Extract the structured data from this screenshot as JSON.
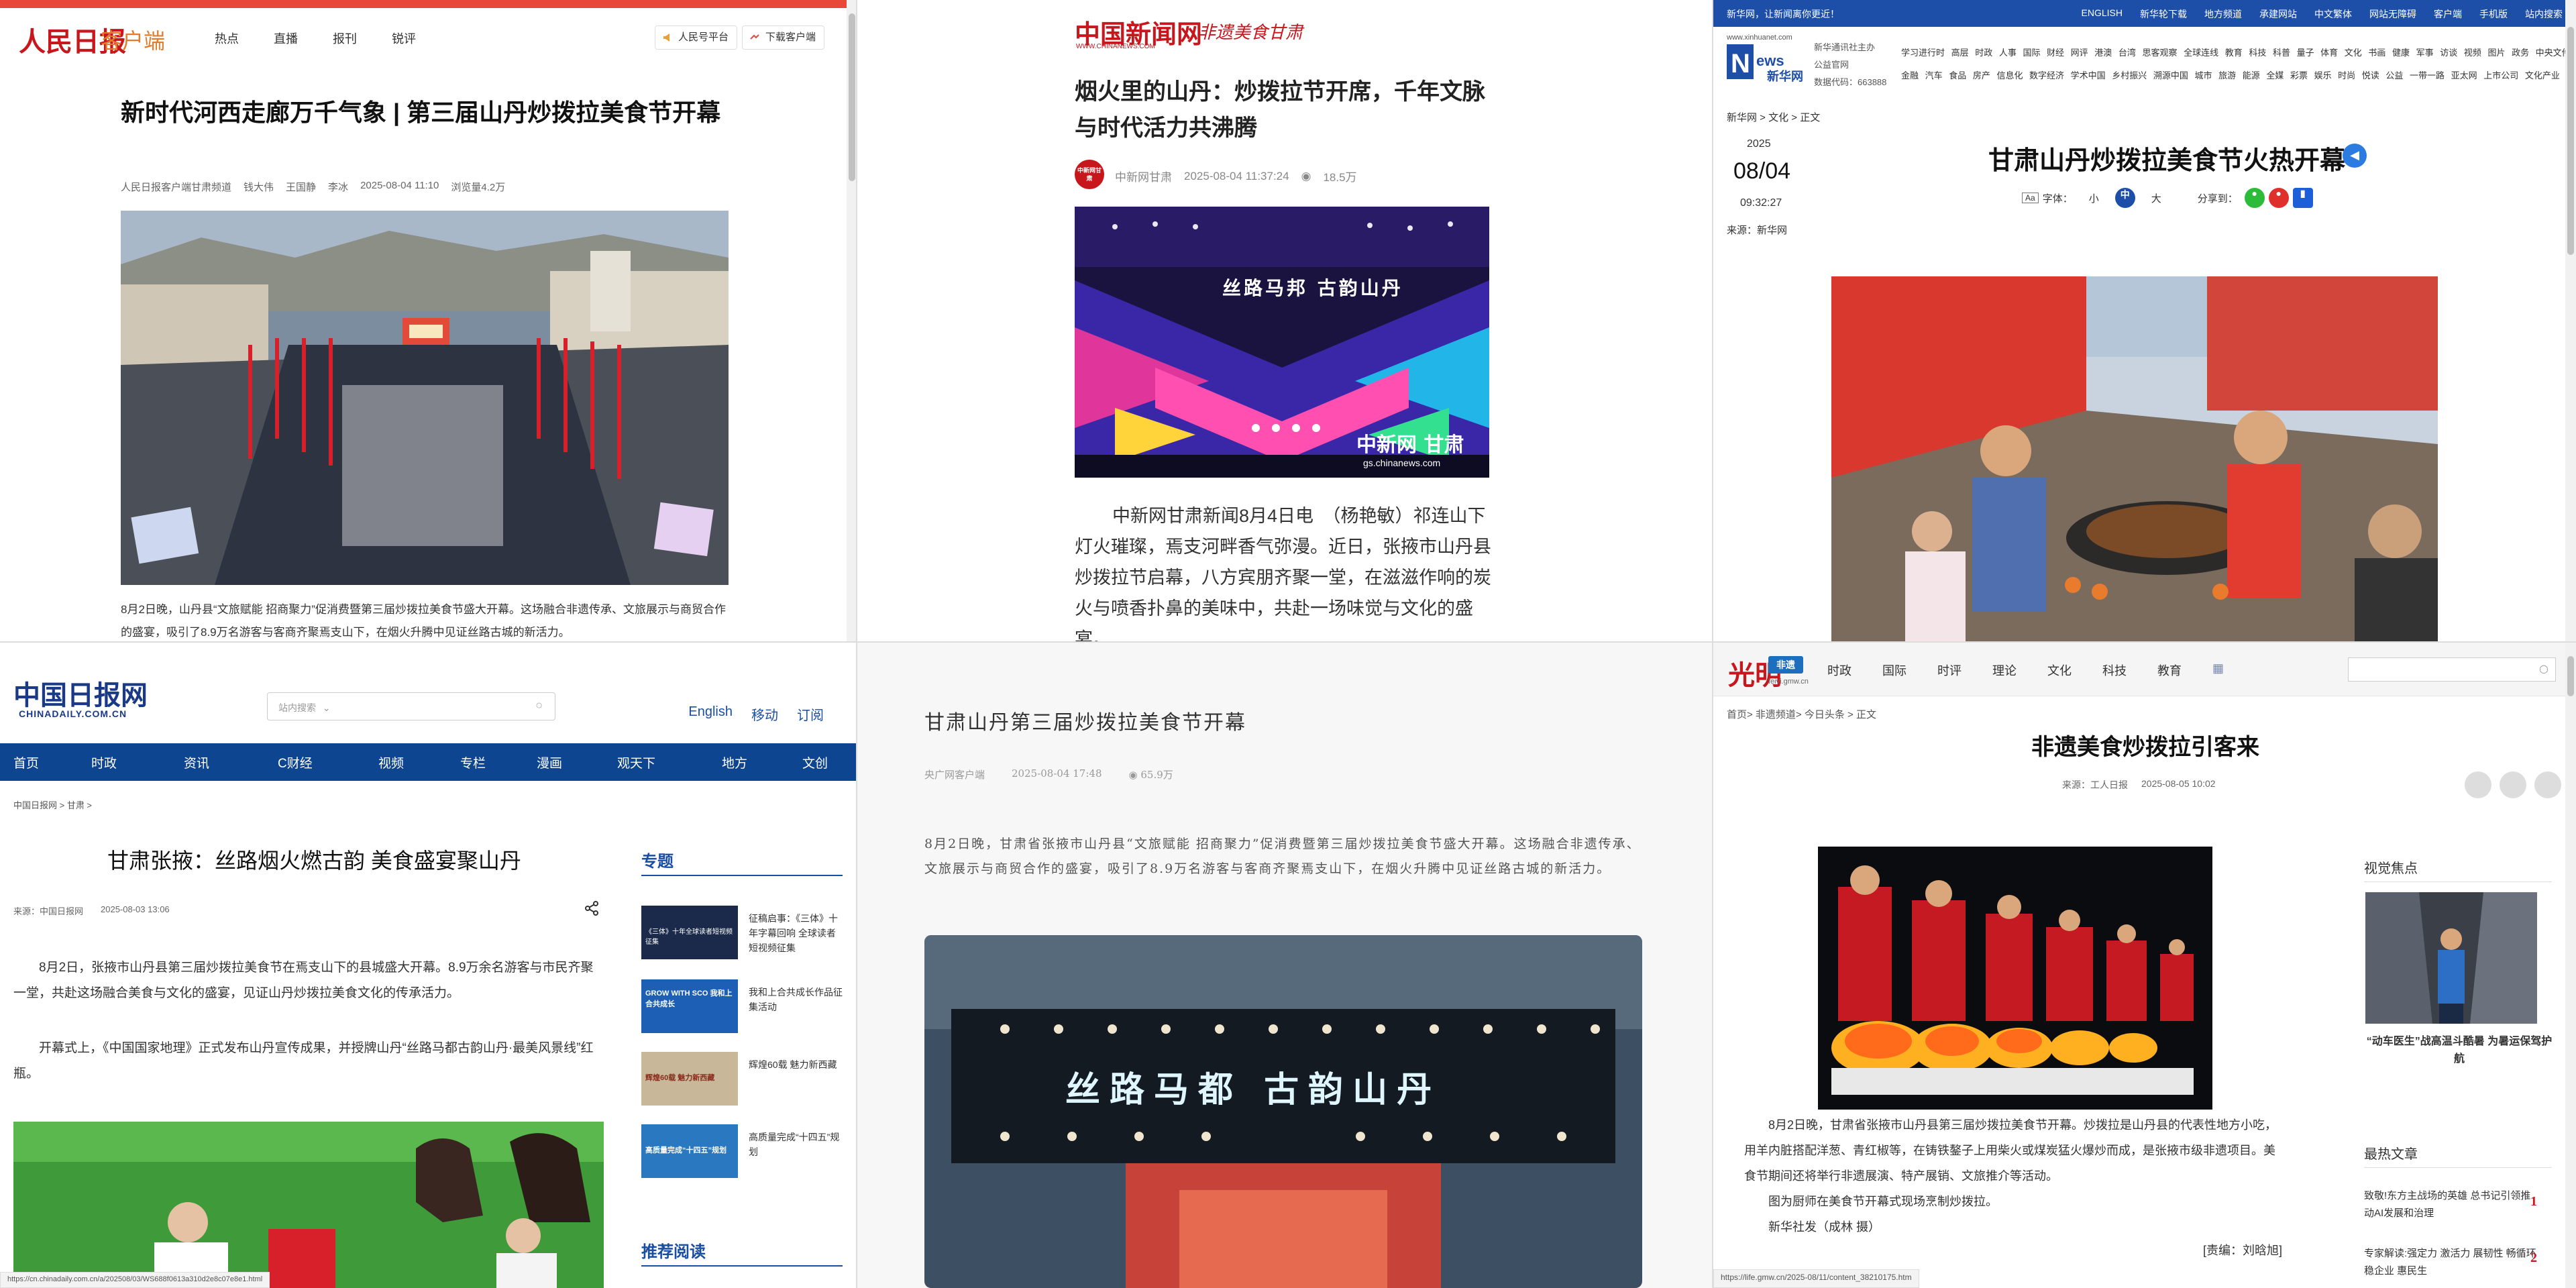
{
  "panel1": {
    "logo": "人民日报",
    "logo_sub": "客户端",
    "nav": [
      "热点",
      "直播",
      "报刊",
      "锐评"
    ],
    "btn_platform": "人民号平台",
    "btn_download": "下载客户端",
    "title": "新时代河西走廊万千气象 | 第三届山丹炒拨拉美食节开幕",
    "meta": [
      "人民日报客户端甘肃频道",
      "钱大伟",
      "王国静",
      "李冰",
      "2025-08-04 11:10",
      "浏览量4.2万"
    ],
    "caption": "8月2日晚，山丹县“文旅赋能 招商聚力”促消费暨第三届炒拨拉美食节盛大开幕。这场融合非遗传承、文旅展示与商贸合作的盛宴，吸引了8.9万名游客与客商齐聚焉支山下，在烟火升腾中见证丝路古城的新活力。"
  },
  "panel2": {
    "logo": "中国新闻网",
    "logo_sub": "非遗美食甘肃",
    "logo_url": "WWW.CHINANEWS.COM",
    "title": "烟火里的山丹：炒拨拉节开席，千年文脉与时代活力共沸腾",
    "avatar_text": "中新网甘肃",
    "source": "中新网甘肃",
    "time": "2025-08-04 11:37:24",
    "views": "18.5万",
    "image_banner": "丝路马邦 古韵山丹",
    "image_watermark": "中新网 甘肃",
    "image_url": "gs.chinanews.com",
    "body": "中新网甘肃新闻8月4日电　（杨艳敏）祁连山下灯火璀璨，焉支河畔香气弥漫。近日，张掖市山丹县炒拨拉节启幕，八方宾朋齐聚一堂，在滋滋作响的炭火与喷香扑鼻的美味中，共赴一场味觉与文化的盛宴。"
  },
  "panel3": {
    "topbar_left": "新华网，让新闻离你更近！",
    "topbar_right": [
      "ENGLISH",
      "新华轮下载",
      "地方频道",
      "承建网站",
      "中文繁体",
      "网站无障碍",
      "客户端",
      "手机版",
      "站内搜索"
    ],
    "logo": "新华网",
    "logo_url": "www.xinhuanet.com",
    "logo_text": [
      "新华通讯社主办",
      "公益官网",
      "数据代码：663888"
    ],
    "links_line1": "学习进行时 高层 时政 人事 国际 财经 网评 港澳 台湾 思客观察 全球连线 教育 科技 科普 量子 体育 文化 书画 健康 军事 访谈 视频 图片 政务 中央文件",
    "links_line2": "金融 汽车 食品 房产 信息化 数字经济 学术中国 乡村振兴 溯源中国 城市 旅游 能源 全媒 彩票 娱乐 时尚 悦读 公益 一带一路 亚太网 上市公司 文化产业",
    "breadcrumb": "新华网 > 文化 > 正文",
    "date_year": "2025",
    "date_day": "08/04",
    "date_time": "09:32:27",
    "source": "来源：新华网",
    "title": "甘肃山丹炒拨拉美食节火热开幕",
    "font_label": "字体：",
    "font_small": "小",
    "font_mid": "中",
    "font_big": "大",
    "share_label": "分享到："
  },
  "panel4": {
    "logo": "中国日报网",
    "logo_sub": "CHINADAILY.COM.CN",
    "search_placeholder": "站内搜索",
    "right_links": [
      "English",
      "移动",
      "订阅"
    ],
    "nav": [
      "首页",
      "时政",
      "资讯",
      "C财经",
      "视频",
      "专栏",
      "漫画",
      "观天下",
      "地方",
      "文创"
    ],
    "breadcrumb": "中国日报网 > 甘肃 >",
    "title": "甘肃张掖：丝路烟火燃古韵 美食盛宴聚山丹",
    "meta": [
      "来源：中国日报网",
      "2025-08-03 13:06"
    ],
    "para1": "8月2日，张掖市山丹县第三届炒拨拉美食节在焉支山下的县城盛大开幕。8.9万余名游客与市民齐聚一堂，共赴这场融合美食与文化的盛宴，见证山丹炒拨拉美食文化的传承活力。",
    "para2": "开幕式上，《中国国家地理》正式发布山丹宣传成果，并授牌山丹“丝路马都古韵山丹·最美风景线”红瓶。",
    "side_title": "专题",
    "side_items": [
      {
        "text": "征稿启事：《三体》十年字幕回响 全球读者短视频征集",
        "thumb": "《三体》十年全球读者短视频征集"
      },
      {
        "text": "我和上合共成长作品征集活动",
        "thumb": "GROW WITH SCO 我和上合共成长"
      },
      {
        "text": "辉煌60载 魅力新西藏",
        "thumb": "辉煌60载 魅力新西藏"
      },
      {
        "text": "高质量完成“十四五”规划",
        "thumb": "高质量完成“十四五”规划"
      }
    ],
    "side_title2": "推荐阅读",
    "status_url": "https://cn.chinadaily.com.cn/a/202508/03/WS688f0613a310d2e8c07e8e1.html"
  },
  "panel5": {
    "title": "甘肃山丹第三届炒拨拉美食节开幕",
    "source": "央广网客户端",
    "time": "2025-08-04 17:48",
    "views": "65.9万",
    "body": "8月2日晚，甘肃省张掖市山丹县“文旅赋能 招商聚力”促消费暨第三届炒拨拉美食节盛大开幕。这场融合非遗传承、文旅展示与商贸合作的盛宴，吸引了8.9万名游客与客商齐聚焉支山下，在烟火升腾中见证丝路古城的新活力。",
    "image_sign": "丝路马都 古韵山丹"
  },
  "panel6": {
    "logo": "光明",
    "logo_badge": "非遗",
    "logo_url": "feiyi.gmw.cn",
    "nav": [
      "时政",
      "国际",
      "时评",
      "理论",
      "文化",
      "科技",
      "教育"
    ],
    "breadcrumb": "首页> 非遗频道> 今日头条 > 正文",
    "title": "非遗美食炒拨拉引客来",
    "meta": [
      "来源：工人日报",
      "2025-08-05 10:02"
    ],
    "body1": "8月2日晚，甘肃省张掖市山丹县第三届炒拨拉美食节开幕。炒拨拉是山丹县的代表性地方小吃，用羊内脏搭配洋葱、青红椒等，在铸铁鏊子上用柴火或煤炭猛火爆炒而成，是张掖市级非遗项目。美食节期间还将举行非遗展演、特产展销、文旅推介等活动。",
    "body2": "图为厨师在美食节开幕式现场烹制炒拨拉。",
    "body3": "新华社发（成林 摄）",
    "editor": "[责编：刘晗旭]",
    "side_title1": "视觉焦点",
    "focus_caption": "“动车医生”战高温斗酷暑 为暑运保驾护航",
    "side_title2": "最热文章",
    "hot": [
      {
        "num": "1",
        "text": "致敬!东方主战场的英雄 总书记引领推动AI发展和治理"
      },
      {
        "num": "2",
        "text": "专家解读:强定力 激活力 展韧性 畅循环 稳企业 惠民生"
      }
    ],
    "status_url": "https://life.gmw.cn/2025-08/11/content_38210175.htm"
  },
  "colors": {
    "people_red": "#c8161d",
    "xinhua_blue": "#1d4fa8",
    "chinadaily_blue": "#0e4590"
  }
}
